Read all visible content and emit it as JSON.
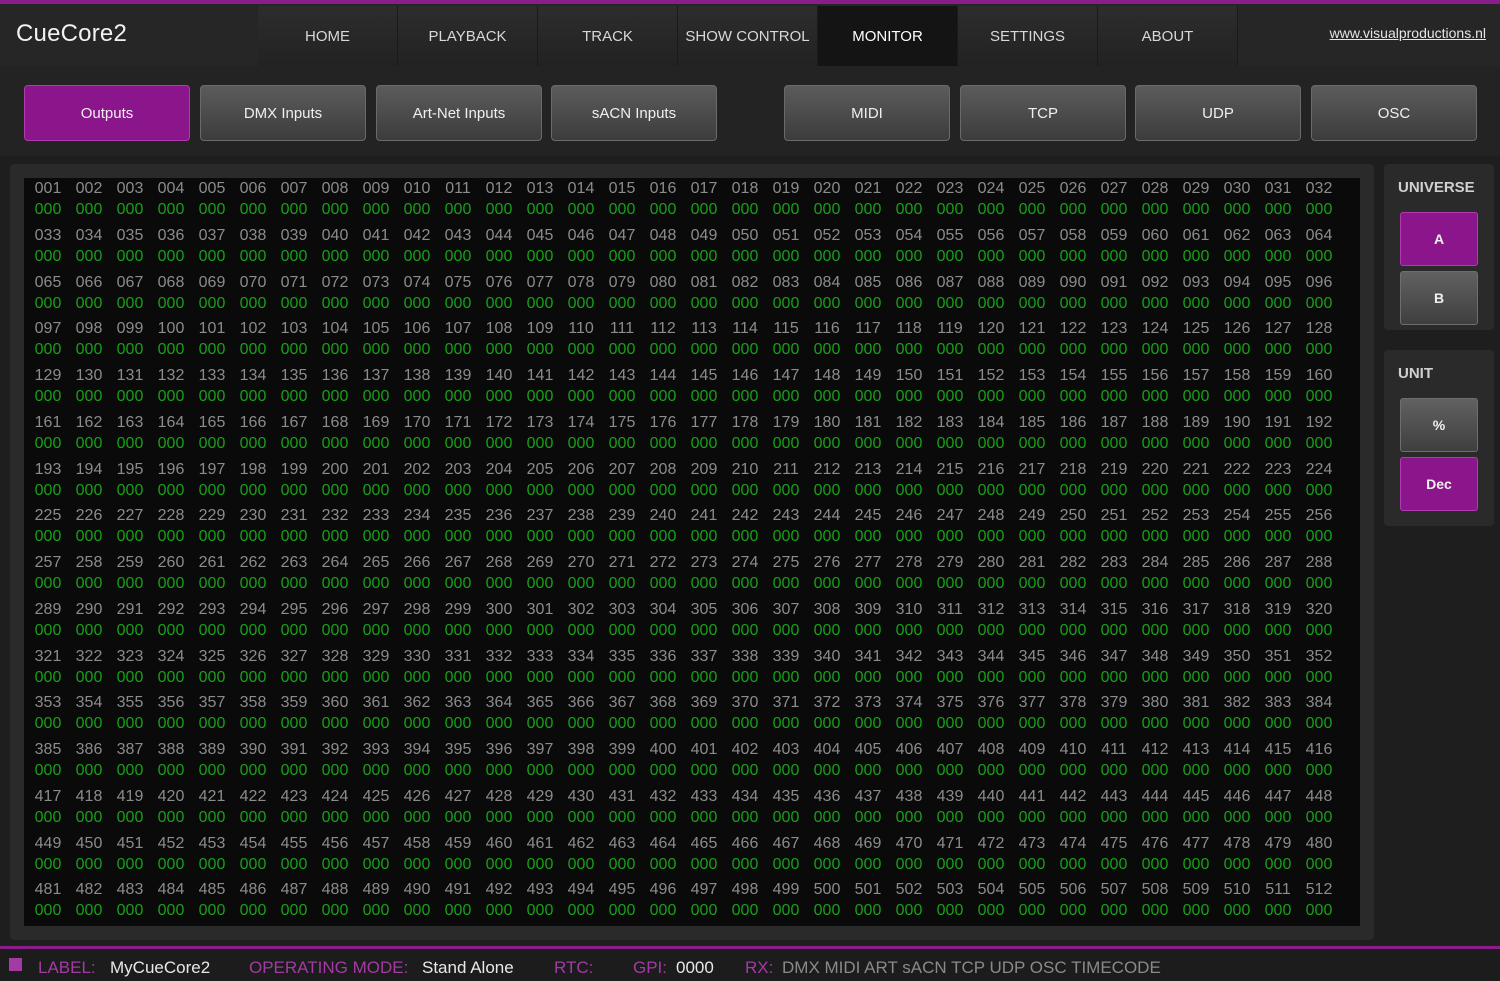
{
  "app": {
    "title": "CueCore2",
    "site_link": "www.visualproductions.nl"
  },
  "nav": {
    "items": [
      {
        "label": "HOME",
        "active": false
      },
      {
        "label": "PLAYBACK",
        "active": false
      },
      {
        "label": "TRACK",
        "active": false
      },
      {
        "label": "SHOW CONTROL",
        "active": false
      },
      {
        "label": "MONITOR",
        "active": true
      },
      {
        "label": "SETTINGS",
        "active": false
      },
      {
        "label": "ABOUT",
        "active": false
      }
    ]
  },
  "subnav": {
    "items": [
      {
        "label": "Outputs",
        "active": true
      },
      {
        "label": "DMX Inputs",
        "active": false
      },
      {
        "label": "Art-Net Inputs",
        "active": false
      },
      {
        "label": "sACN Inputs",
        "active": false
      },
      {
        "label": "MIDI",
        "active": false
      },
      {
        "label": "TCP",
        "active": false
      },
      {
        "label": "UDP",
        "active": false
      },
      {
        "label": "OSC",
        "active": false
      }
    ]
  },
  "monitor": {
    "channel_count": 512,
    "channels_per_row": 32,
    "default_value": "000"
  },
  "universe": {
    "title": "UNIVERSE",
    "options": [
      {
        "label": "A",
        "active": true
      },
      {
        "label": "B",
        "active": false
      }
    ]
  },
  "unit": {
    "title": "UNIT",
    "options": [
      {
        "label": "%",
        "active": false
      },
      {
        "label": "Dec",
        "active": true
      }
    ]
  },
  "footer": {
    "label_key": "LABEL:",
    "label_value": "MyCueCore2",
    "mode_key": "OPERATING MODE:",
    "mode_value": "Stand Alone",
    "rtc_key": "RTC:",
    "gpi_key": "GPI:",
    "gpi_value": "0000",
    "rx_key": "RX:",
    "rx_value": "DMX MIDI ART sACN TCP UDP OSC TIMECODE"
  },
  "colors": {
    "accent": "#8b158b",
    "value_green": "#18a018",
    "channel_gray": "#8c8c8c"
  }
}
